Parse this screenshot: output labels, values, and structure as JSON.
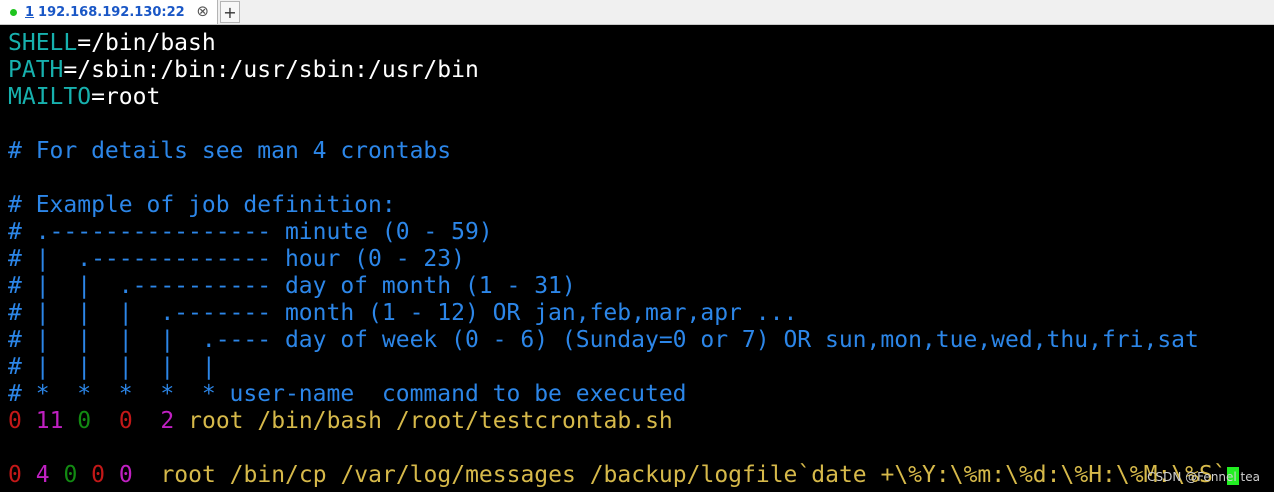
{
  "tab": {
    "number": "1",
    "title": "192.168.192.130:22",
    "close_glyph": "⊗",
    "add_glyph": "+"
  },
  "terminal": {
    "env": [
      {
        "name": "SHELL",
        "value": "=/bin/bash"
      },
      {
        "name": "PATH",
        "value": "=/sbin:/bin:/usr/sbin:/usr/bin"
      },
      {
        "name": "MAILTO",
        "value": "=root"
      }
    ],
    "comments": [
      "# For details see man 4 crontabs",
      "# Example of job definition:",
      "# .---------------- minute (0 - 59)",
      "# |  .------------- hour (0 - 23)",
      "# |  |  .---------- day of month (1 - 31)",
      "# |  |  |  .------- month (1 - 12) OR jan,feb,mar,apr ...",
      "# |  |  |  |  .---- day of week (0 - 6) (Sunday=0 or 7) OR sun,mon,tue,wed,thu,fri,sat",
      "# |  |  |  |  |",
      "# *  *  *  *  * user-name  command to be executed"
    ],
    "job1": {
      "f1": "0",
      "f2": "11",
      "f3": "0",
      "f4": "0",
      "f5": "2",
      "cmd": "root /bin/bash /root/testcrontab.sh"
    },
    "job2": {
      "f1": "0",
      "f2": "4",
      "f3": "0",
      "f4": "0",
      "f5": "0",
      "cmd": "root /bin/cp /var/log/messages /backup/logfile`date +\\%Y:\\%m:\\%d:\\%H:\\%M:\\%S`"
    }
  },
  "watermark": "CSDN @Fennel tea",
  "colors": {
    "background": "#000000",
    "env_name": "#17b1ae",
    "comment": "#2c86e8",
    "command": "#d6b94a",
    "cursor": "#22ee22"
  }
}
